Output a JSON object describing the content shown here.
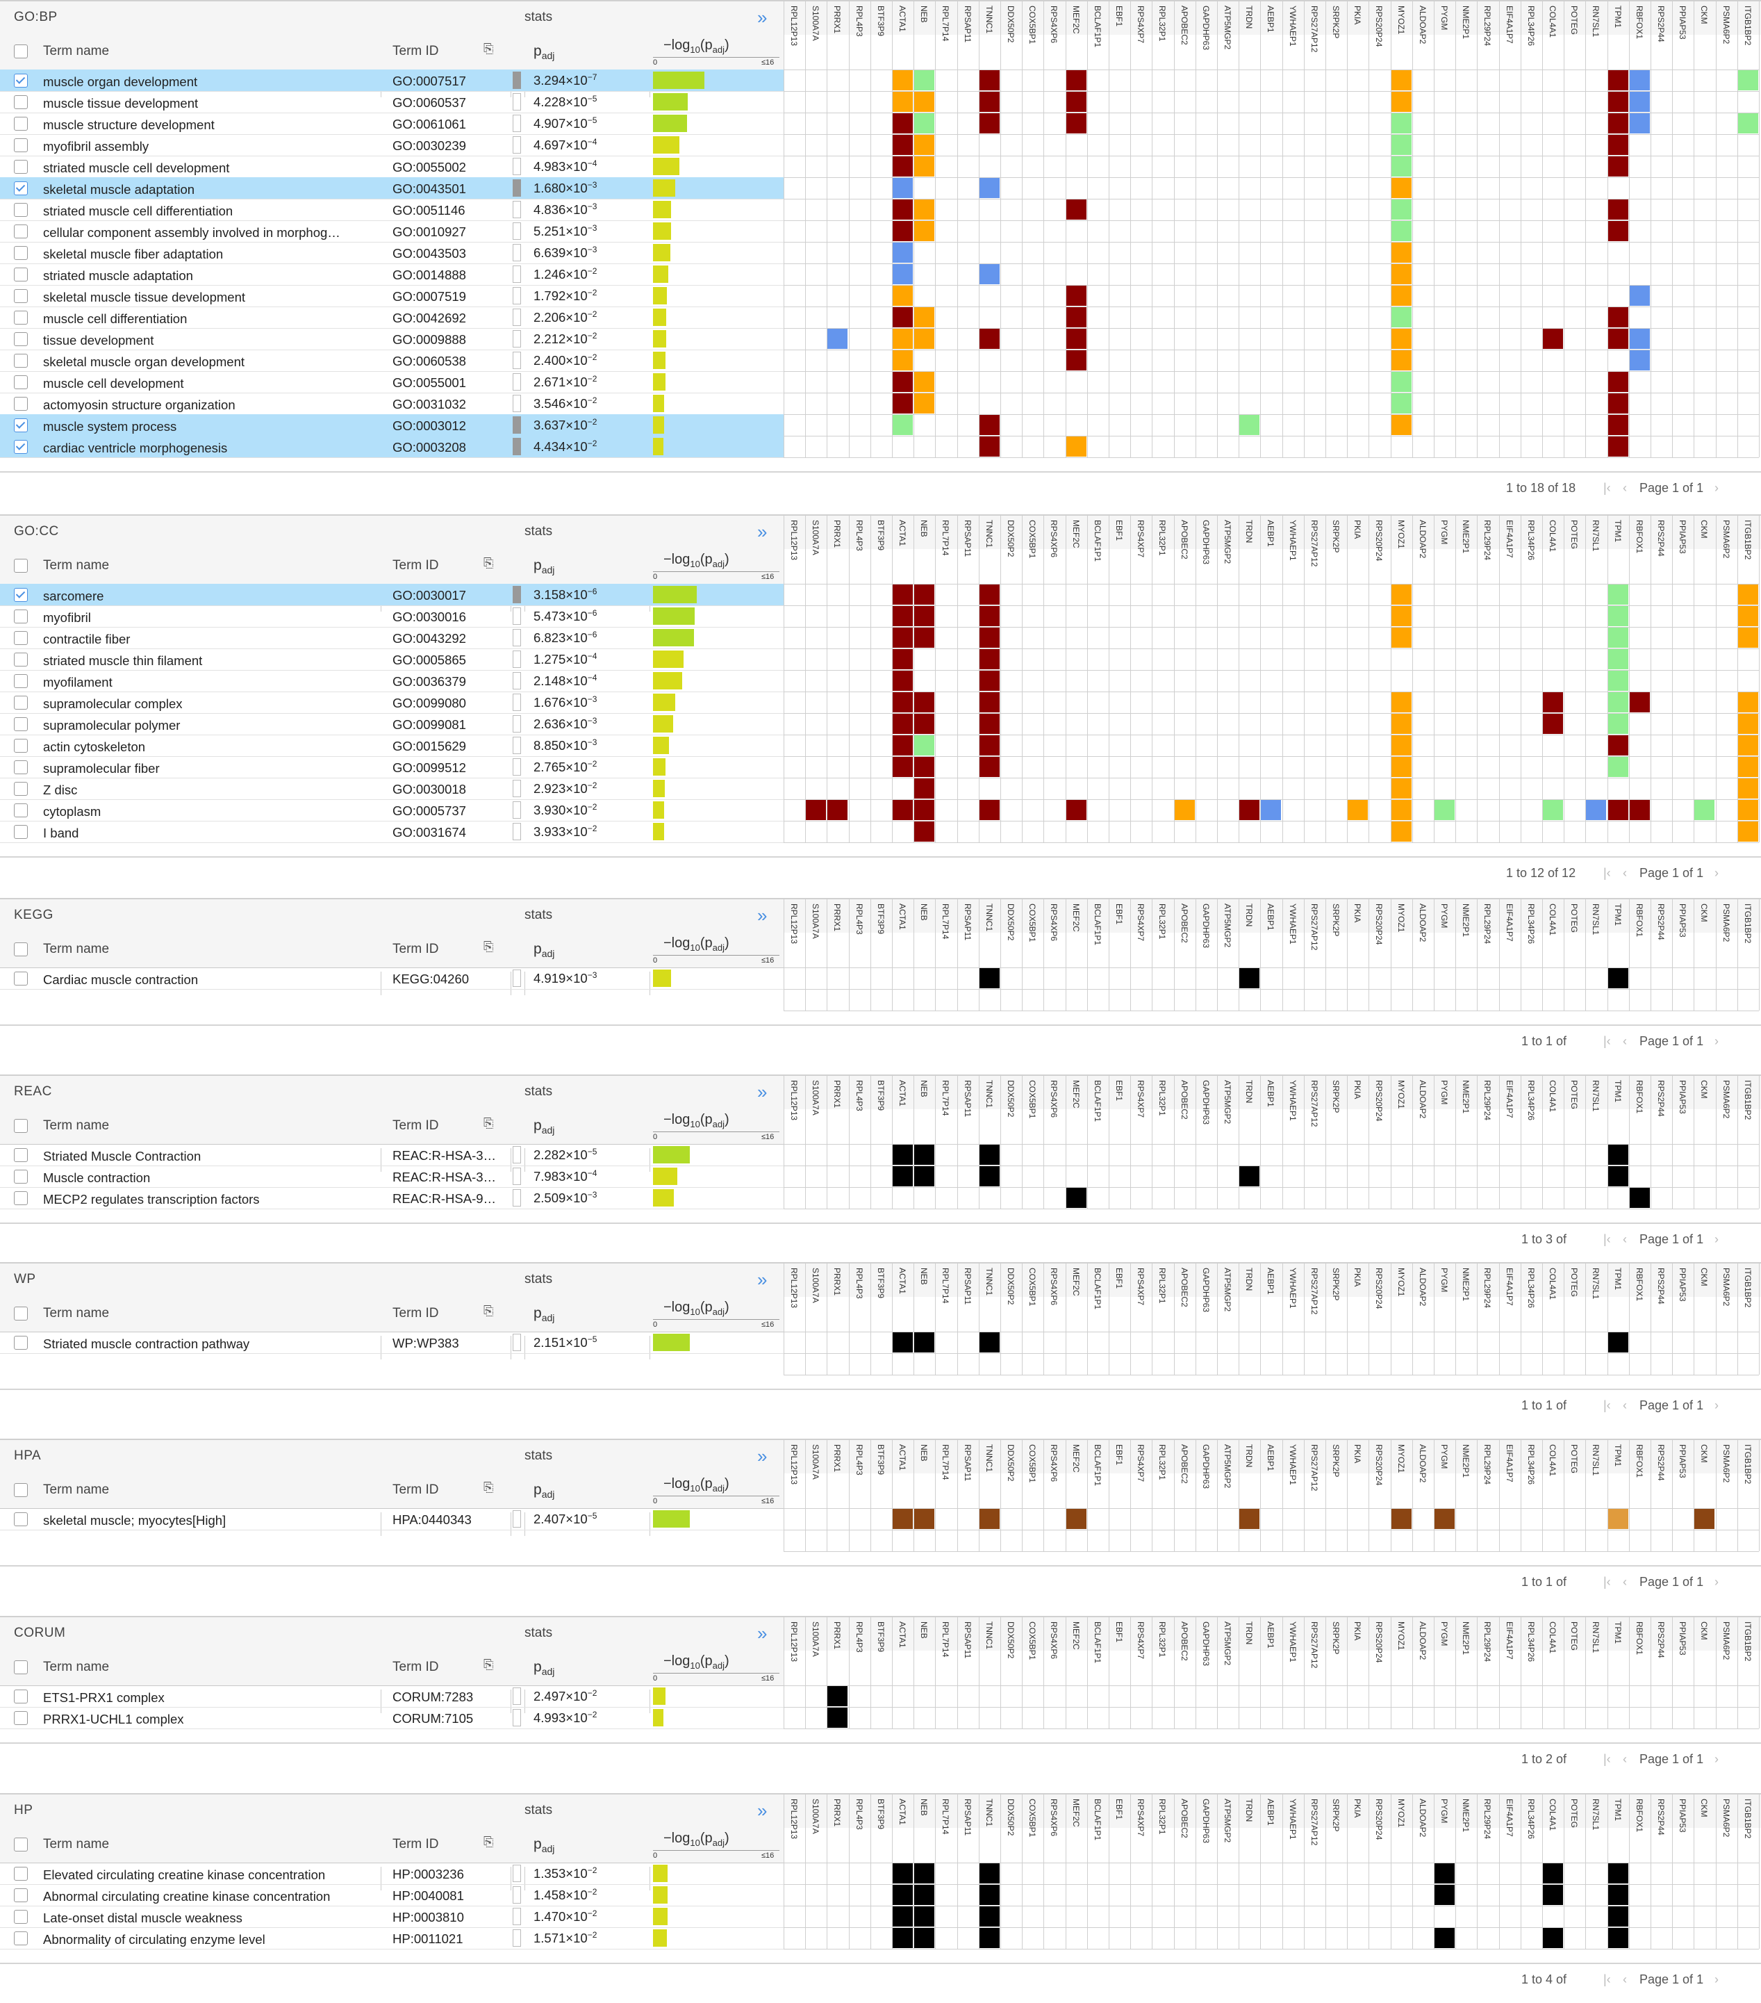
{
  "gene_columns": [
    "RPL12P13",
    "S100A7A",
    "PRRX1",
    "RPL4P3",
    "BTF3P9",
    "ACTA1",
    "NEB",
    "RPL7P14",
    "RPSAP11",
    "TNNC1",
    "DDX50P2",
    "COX5BP1",
    "RPS4XP6",
    "MEF2C",
    "BCLAF1P1",
    "EBF1",
    "RPS4XP7",
    "RPL32P1",
    "APOBEC2",
    "GAPDHP63",
    "ATP5MGP2",
    "TRDN",
    "AEBP1",
    "YWHAEP1",
    "RPS27AP12",
    "SRPK2P",
    "PKIA",
    "RPS20P24",
    "MYOZ1",
    "ALDOAP2",
    "PYGM",
    "NME2P1",
    "RPL29P24",
    "EIF4A1P7",
    "RPL34P26",
    "COL4A1",
    "POTEG",
    "RN7SL1",
    "TPM1",
    "RBFOX1",
    "RPS2P44",
    "PPIAP53",
    "CKM",
    "PSMA6P2",
    "ITGB1BP2"
  ],
  "colors": {
    "dark_red": "#8b0000",
    "orange": "#ffa500",
    "light_green": "#90ee90",
    "blue": "#6495ed",
    "black": "#000000",
    "brown": "#8b4513",
    "light_brown": "#e09b3d",
    "bar_yellow": "#d6dc1a",
    "bar_green": "#b0dc28",
    "selected_row": "#b3e0fa"
  },
  "header_labels": {
    "term_name": "Term name",
    "term_id": "Term ID",
    "stats": "stats",
    "padj": "p",
    "padj_sub": "adj",
    "log_prefix": "−log",
    "log_sub": "10",
    "log_mid": "(p",
    "log_sub2": "adj",
    "log_suffix": ")",
    "scale_zero": "0",
    "scale_max": "≤16",
    "expand_icon": "»"
  },
  "sections": [
    {
      "title": "GO:BP",
      "pager": {
        "range": "1 to 18 of 18",
        "page": "Page 1 of 1"
      },
      "rows": [
        {
          "term": "muscle organ development",
          "id": "GO:0007517",
          "mant": "3.294",
          "exp": "−7",
          "bar": 6.48,
          "sel": true,
          "cells": {
            "ACTA1": "orange",
            "NEB": "light_green",
            "TNNC1": "dark_red",
            "MEF2C": "dark_red",
            "MYOZ1": "orange",
            "TPM1": "dark_red",
            "RBFOX1": "blue",
            "ITGB1BP2": "light_green"
          }
        },
        {
          "term": "muscle tissue development",
          "id": "GO:0060537",
          "mant": "4.228",
          "exp": "−5",
          "bar": 4.37,
          "sel": false,
          "cells": {
            "ACTA1": "orange",
            "NEB": "orange",
            "TNNC1": "dark_red",
            "MEF2C": "dark_red",
            "MYOZ1": "orange",
            "TPM1": "dark_red",
            "RBFOX1": "blue"
          }
        },
        {
          "term": "muscle structure development",
          "id": "GO:0061061",
          "mant": "4.907",
          "exp": "−5",
          "bar": 4.31,
          "sel": false,
          "cells": {
            "ACTA1": "dark_red",
            "NEB": "light_green",
            "TNNC1": "dark_red",
            "MEF2C": "dark_red",
            "MYOZ1": "light_green",
            "TPM1": "dark_red",
            "RBFOX1": "blue",
            "ITGB1BP2": "light_green"
          }
        },
        {
          "term": "myofibril assembly",
          "id": "GO:0030239",
          "mant": "4.697",
          "exp": "−4",
          "bar": 3.33,
          "sel": false,
          "cells": {
            "ACTA1": "dark_red",
            "NEB": "orange",
            "MYOZ1": "light_green",
            "TPM1": "dark_red"
          }
        },
        {
          "term": "striated muscle cell development",
          "id": "GO:0055002",
          "mant": "4.983",
          "exp": "−4",
          "bar": 3.3,
          "sel": false,
          "cells": {
            "ACTA1": "dark_red",
            "NEB": "orange",
            "MYOZ1": "light_green",
            "TPM1": "dark_red"
          }
        },
        {
          "term": "skeletal muscle adaptation",
          "id": "GO:0043501",
          "mant": "1.680",
          "exp": "−3",
          "bar": 2.77,
          "sel": true,
          "cells": {
            "ACTA1": "blue",
            "TNNC1": "blue",
            "MYOZ1": "orange"
          }
        },
        {
          "term": "striated muscle cell differentiation",
          "id": "GO:0051146",
          "mant": "4.836",
          "exp": "−3",
          "bar": 2.32,
          "sel": false,
          "cells": {
            "ACTA1": "dark_red",
            "NEB": "orange",
            "MEF2C": "dark_red",
            "MYOZ1": "light_green",
            "TPM1": "dark_red"
          }
        },
        {
          "term": "cellular component assembly involved in morphog…",
          "id": "GO:0010927",
          "mant": "5.251",
          "exp": "−3",
          "bar": 2.28,
          "sel": false,
          "cells": {
            "ACTA1": "dark_red",
            "NEB": "orange",
            "MYOZ1": "light_green",
            "TPM1": "dark_red"
          }
        },
        {
          "term": "skeletal muscle fiber adaptation",
          "id": "GO:0043503",
          "mant": "6.639",
          "exp": "−3",
          "bar": 2.18,
          "sel": false,
          "cells": {
            "ACTA1": "blue",
            "MYOZ1": "orange"
          }
        },
        {
          "term": "striated muscle adaptation",
          "id": "GO:0014888",
          "mant": "1.246",
          "exp": "−2",
          "bar": 1.9,
          "sel": false,
          "cells": {
            "ACTA1": "blue",
            "TNNC1": "blue",
            "MYOZ1": "orange"
          }
        },
        {
          "term": "skeletal muscle tissue development",
          "id": "GO:0007519",
          "mant": "1.792",
          "exp": "−2",
          "bar": 1.75,
          "sel": false,
          "cells": {
            "ACTA1": "orange",
            "MEF2C": "dark_red",
            "MYOZ1": "orange",
            "RBFOX1": "blue"
          }
        },
        {
          "term": "muscle cell differentiation",
          "id": "GO:0042692",
          "mant": "2.206",
          "exp": "−2",
          "bar": 1.66,
          "sel": false,
          "cells": {
            "ACTA1": "dark_red",
            "NEB": "orange",
            "MEF2C": "dark_red",
            "MYOZ1": "light_green",
            "TPM1": "dark_red"
          }
        },
        {
          "term": "tissue development",
          "id": "GO:0009888",
          "mant": "2.212",
          "exp": "−2",
          "bar": 1.66,
          "sel": false,
          "cells": {
            "PRRX1": "blue",
            "ACTA1": "orange",
            "NEB": "orange",
            "TNNC1": "dark_red",
            "MEF2C": "dark_red",
            "MYOZ1": "orange",
            "COL4A1": "dark_red",
            "TPM1": "dark_red",
            "RBFOX1": "blue"
          }
        },
        {
          "term": "skeletal muscle organ development",
          "id": "GO:0060538",
          "mant": "2.400",
          "exp": "−2",
          "bar": 1.62,
          "sel": false,
          "cells": {
            "ACTA1": "orange",
            "MEF2C": "dark_red",
            "MYOZ1": "orange",
            "RBFOX1": "blue"
          }
        },
        {
          "term": "muscle cell development",
          "id": "GO:0055001",
          "mant": "2.671",
          "exp": "−2",
          "bar": 1.57,
          "sel": false,
          "cells": {
            "ACTA1": "dark_red",
            "NEB": "orange",
            "MYOZ1": "light_green",
            "TPM1": "dark_red"
          }
        },
        {
          "term": "actomyosin structure organization",
          "id": "GO:0031032",
          "mant": "3.546",
          "exp": "−2",
          "bar": 1.45,
          "sel": false,
          "cells": {
            "ACTA1": "dark_red",
            "NEB": "orange",
            "MYOZ1": "light_green",
            "TPM1": "dark_red"
          }
        },
        {
          "term": "muscle system process",
          "id": "GO:0003012",
          "mant": "3.637",
          "exp": "−2",
          "bar": 1.44,
          "sel": true,
          "cells": {
            "ACTA1": "light_green",
            "TNNC1": "dark_red",
            "TRDN": "light_green",
            "MYOZ1": "orange",
            "TPM1": "dark_red"
          }
        },
        {
          "term": "cardiac ventricle morphogenesis",
          "id": "GO:0003208",
          "mant": "4.434",
          "exp": "−2",
          "bar": 1.35,
          "sel": true,
          "cells": {
            "TNNC1": "dark_red",
            "MEF2C": "orange",
            "TPM1": "dark_red"
          }
        }
      ]
    },
    {
      "title": "GO:CC",
      "pager": {
        "range": "1 to 12 of 12",
        "page": "Page 1 of 1"
      },
      "rows": [
        {
          "term": "sarcomere",
          "id": "GO:0030017",
          "mant": "3.158",
          "exp": "−6",
          "bar": 5.5,
          "sel": true,
          "cells": {
            "ACTA1": "dark_red",
            "NEB": "dark_red",
            "TNNC1": "dark_red",
            "MYOZ1": "orange",
            "TPM1": "light_green",
            "ITGB1BP2": "orange"
          }
        },
        {
          "term": "myofibril",
          "id": "GO:0030016",
          "mant": "5.473",
          "exp": "−6",
          "bar": 5.26,
          "sel": false,
          "cells": {
            "ACTA1": "dark_red",
            "NEB": "dark_red",
            "TNNC1": "dark_red",
            "MYOZ1": "orange",
            "TPM1": "light_green",
            "ITGB1BP2": "orange"
          }
        },
        {
          "term": "contractile fiber",
          "id": "GO:0043292",
          "mant": "6.823",
          "exp": "−6",
          "bar": 5.17,
          "sel": false,
          "cells": {
            "ACTA1": "dark_red",
            "NEB": "dark_red",
            "TNNC1": "dark_red",
            "MYOZ1": "orange",
            "TPM1": "light_green",
            "ITGB1BP2": "orange"
          }
        },
        {
          "term": "striated muscle thin filament",
          "id": "GO:0005865",
          "mant": "1.275",
          "exp": "−4",
          "bar": 3.89,
          "sel": false,
          "cells": {
            "ACTA1": "dark_red",
            "TNNC1": "dark_red",
            "TPM1": "light_green"
          }
        },
        {
          "term": "myofilament",
          "id": "GO:0036379",
          "mant": "2.148",
          "exp": "−4",
          "bar": 3.67,
          "sel": false,
          "cells": {
            "ACTA1": "dark_red",
            "TNNC1": "dark_red",
            "TPM1": "light_green"
          }
        },
        {
          "term": "supramolecular complex",
          "id": "GO:0099080",
          "mant": "1.676",
          "exp": "−3",
          "bar": 2.78,
          "sel": false,
          "cells": {
            "ACTA1": "dark_red",
            "NEB": "dark_red",
            "TNNC1": "dark_red",
            "MYOZ1": "orange",
            "COL4A1": "dark_red",
            "TPM1": "light_green",
            "RBFOX1": "dark_red",
            "ITGB1BP2": "orange"
          }
        },
        {
          "term": "supramolecular polymer",
          "id": "GO:0099081",
          "mant": "2.636",
          "exp": "−3",
          "bar": 2.58,
          "sel": false,
          "cells": {
            "ACTA1": "dark_red",
            "NEB": "dark_red",
            "TNNC1": "dark_red",
            "MYOZ1": "orange",
            "COL4A1": "dark_red",
            "TPM1": "light_green",
            "ITGB1BP2": "orange"
          }
        },
        {
          "term": "actin cytoskeleton",
          "id": "GO:0015629",
          "mant": "8.850",
          "exp": "−3",
          "bar": 2.05,
          "sel": false,
          "cells": {
            "ACTA1": "dark_red",
            "NEB": "light_green",
            "TNNC1": "dark_red",
            "MYOZ1": "orange",
            "TPM1": "dark_red",
            "ITGB1BP2": "orange"
          }
        },
        {
          "term": "supramolecular fiber",
          "id": "GO:0099512",
          "mant": "2.765",
          "exp": "−2",
          "bar": 1.56,
          "sel": false,
          "cells": {
            "ACTA1": "dark_red",
            "NEB": "dark_red",
            "TNNC1": "dark_red",
            "MYOZ1": "orange",
            "TPM1": "light_green",
            "ITGB1BP2": "orange"
          }
        },
        {
          "term": "Z disc",
          "id": "GO:0030018",
          "mant": "2.923",
          "exp": "−2",
          "bar": 1.53,
          "sel": false,
          "cells": {
            "NEB": "dark_red",
            "MYOZ1": "orange",
            "ITGB1BP2": "orange"
          }
        },
        {
          "term": "cytoplasm",
          "id": "GO:0005737",
          "mant": "3.930",
          "exp": "−2",
          "bar": 1.41,
          "sel": false,
          "cells": {
            "S100A7A": "dark_red",
            "PRRX1": "dark_red",
            "ACTA1": "dark_red",
            "NEB": "dark_red",
            "TNNC1": "dark_red",
            "MEF2C": "dark_red",
            "APOBEC2": "orange",
            "TRDN": "dark_red",
            "AEBP1": "blue",
            "PKIA": "orange",
            "MYOZ1": "orange",
            "PYGM": "light_green",
            "COL4A1": "light_green",
            "RN7SL1": "blue",
            "TPM1": "dark_red",
            "RBFOX1": "dark_red",
            "CKM": "light_green",
            "ITGB1BP2": "orange"
          }
        },
        {
          "term": "I band",
          "id": "GO:0031674",
          "mant": "3.933",
          "exp": "−2",
          "bar": 1.41,
          "sel": false,
          "cells": {
            "NEB": "dark_red",
            "MYOZ1": "orange",
            "ITGB1BP2": "orange"
          }
        }
      ]
    },
    {
      "title": "KEGG",
      "pager": {
        "range": "1 to 1 of",
        "page": "Page 1 of 1"
      },
      "rows": [
        {
          "term": "Cardiac muscle contraction",
          "id": "KEGG:04260",
          "mant": "4.919",
          "exp": "−3",
          "bar": 2.31,
          "sel": false,
          "cells": {
            "TNNC1": "black",
            "TRDN": "black",
            "TPM1": "black"
          }
        }
      ]
    },
    {
      "title": "REAC",
      "pager": {
        "range": "1 to 3 of",
        "page": "Page 1 of 1"
      },
      "rows": [
        {
          "term": "Striated Muscle Contraction",
          "id": "REAC:R-HSA-3…",
          "mant": "2.282",
          "exp": "−5",
          "bar": 4.64,
          "sel": false,
          "cells": {
            "ACTA1": "black",
            "NEB": "black",
            "TNNC1": "black",
            "TPM1": "black"
          }
        },
        {
          "term": "Muscle contraction",
          "id": "REAC:R-HSA-3…",
          "mant": "7.983",
          "exp": "−4",
          "bar": 3.1,
          "sel": false,
          "cells": {
            "ACTA1": "black",
            "NEB": "black",
            "TNNC1": "black",
            "TRDN": "black",
            "TPM1": "black"
          }
        },
        {
          "term": "MECP2 regulates transcription factors",
          "id": "REAC:R-HSA-9…",
          "mant": "2.509",
          "exp": "−3",
          "bar": 2.6,
          "sel": false,
          "cells": {
            "MEF2C": "black",
            "RBFOX1": "black"
          }
        }
      ]
    },
    {
      "title": "WP",
      "pager": {
        "range": "1 to 1 of",
        "page": "Page 1 of 1"
      },
      "rows": [
        {
          "term": "Striated muscle contraction pathway",
          "id": "WP:WP383",
          "mant": "2.151",
          "exp": "−5",
          "bar": 4.67,
          "sel": false,
          "cells": {
            "ACTA1": "black",
            "NEB": "black",
            "TNNC1": "black",
            "TPM1": "black"
          }
        }
      ]
    },
    {
      "title": "HPA",
      "pager": {
        "range": "1 to 1 of",
        "page": "Page 1 of 1"
      },
      "rows": [
        {
          "term": "skeletal muscle; myocytes[High]",
          "id": "HPA:0440343",
          "mant": "2.407",
          "exp": "−5",
          "bar": 4.62,
          "sel": false,
          "cells": {
            "ACTA1": "brown",
            "NEB": "brown",
            "TNNC1": "brown",
            "MEF2C": "brown",
            "TRDN": "brown",
            "MYOZ1": "brown",
            "PYGM": "brown",
            "TPM1": "light_brown",
            "CKM": "brown"
          }
        }
      ]
    },
    {
      "title": "CORUM",
      "pager": {
        "range": "1 to 2 of",
        "page": "Page 1 of 1"
      },
      "rows": [
        {
          "term": "ETS1-PRX1 complex",
          "id": "CORUM:7283",
          "mant": "2.497",
          "exp": "−2",
          "bar": 1.6,
          "sel": false,
          "cells": {
            "PRRX1": "black"
          }
        },
        {
          "term": "PRRX1-UCHL1 complex",
          "id": "CORUM:7105",
          "mant": "4.993",
          "exp": "−2",
          "bar": 1.3,
          "sel": false,
          "cells": {
            "PRRX1": "black"
          }
        }
      ]
    },
    {
      "title": "HP",
      "pager": {
        "range": "1 to 4 of",
        "page": "Page 1 of 1"
      },
      "rows": [
        {
          "term": "Elevated circulating creatine kinase concentration",
          "id": "HP:0003236",
          "mant": "1.353",
          "exp": "−2",
          "bar": 1.87,
          "sel": false,
          "cells": {
            "ACTA1": "black",
            "NEB": "black",
            "TNNC1": "black",
            "PYGM": "black",
            "COL4A1": "black",
            "TPM1": "black"
          }
        },
        {
          "term": "Abnormal circulating creatine kinase concentration",
          "id": "HP:0040081",
          "mant": "1.458",
          "exp": "−2",
          "bar": 1.84,
          "sel": false,
          "cells": {
            "ACTA1": "black",
            "NEB": "black",
            "TNNC1": "black",
            "PYGM": "black",
            "COL4A1": "black",
            "TPM1": "black"
          }
        },
        {
          "term": "Late-onset distal muscle weakness",
          "id": "HP:0003810",
          "mant": "1.470",
          "exp": "−2",
          "bar": 1.83,
          "sel": false,
          "cells": {
            "ACTA1": "black",
            "NEB": "black",
            "TNNC1": "black",
            "TPM1": "black"
          }
        },
        {
          "term": "Abnormality of circulating enzyme level",
          "id": "HP:0011021",
          "mant": "1.571",
          "exp": "−2",
          "bar": 1.8,
          "sel": false,
          "cells": {
            "ACTA1": "black",
            "NEB": "black",
            "TNNC1": "black",
            "PYGM": "black",
            "COL4A1": "black",
            "TPM1": "black"
          }
        }
      ]
    }
  ]
}
